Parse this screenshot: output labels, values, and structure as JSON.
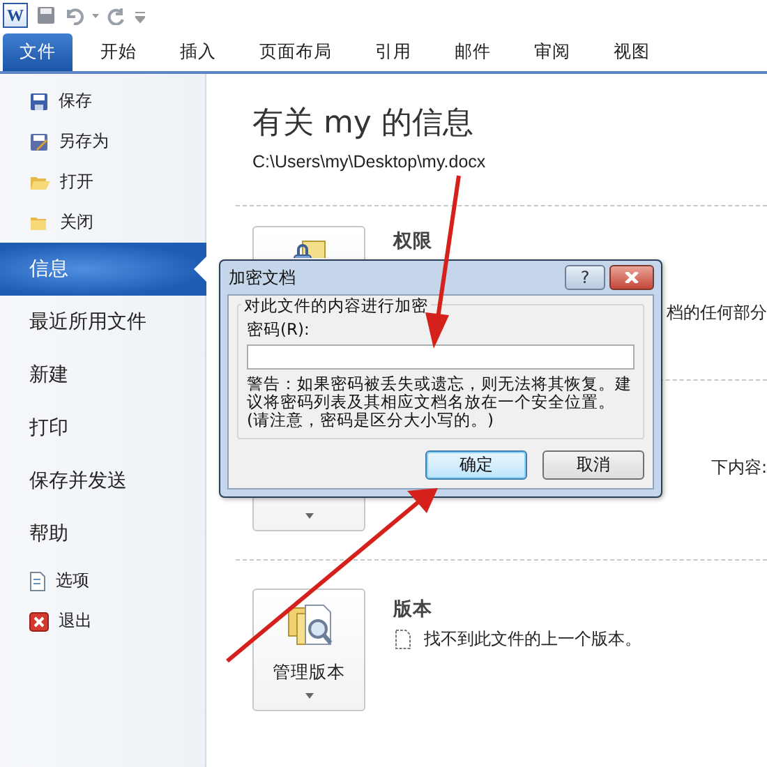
{
  "quick_access": {
    "logo": "W"
  },
  "ribbon_tabs": [
    {
      "label": "文件",
      "kind": "file",
      "selected": true
    },
    {
      "label": "开始",
      "kind": "tab",
      "selected": false
    },
    {
      "label": "插入",
      "kind": "tab",
      "selected": false
    },
    {
      "label": "页面布局",
      "kind": "tab",
      "selected": false
    },
    {
      "label": "引用",
      "kind": "tab",
      "selected": false
    },
    {
      "label": "邮件",
      "kind": "tab",
      "selected": false
    },
    {
      "label": "审阅",
      "kind": "tab",
      "selected": false
    },
    {
      "label": "视图",
      "kind": "tab",
      "selected": false
    }
  ],
  "sidebar": {
    "items": [
      {
        "label": "保存",
        "kind": "command",
        "selected": false
      },
      {
        "label": "另存为",
        "kind": "command",
        "selected": false
      },
      {
        "label": "打开",
        "kind": "command",
        "selected": false
      },
      {
        "label": "关闭",
        "kind": "command",
        "selected": false
      },
      {
        "label": "信息",
        "kind": "page",
        "selected": true
      },
      {
        "label": "最近所用文件",
        "kind": "page",
        "selected": false
      },
      {
        "label": "新建",
        "kind": "page",
        "selected": false
      },
      {
        "label": "打印",
        "kind": "page",
        "selected": false
      },
      {
        "label": "保存并发送",
        "kind": "page",
        "selected": false
      },
      {
        "label": "帮助",
        "kind": "page",
        "selected": false
      },
      {
        "label": "选项",
        "kind": "command",
        "selected": false
      },
      {
        "label": "退出",
        "kind": "command",
        "selected": false
      }
    ]
  },
  "info": {
    "title": "有关 my 的信息",
    "path": "C:\\Users\\my\\Desktop\\my.docx",
    "sections": [
      {
        "heading": "权限",
        "description": "档的任何部分"
      },
      {
        "description": "下内容:"
      },
      {
        "heading": "版本",
        "button_label": "管理版本",
        "description": "找不到此文件的上一个版本。"
      }
    ]
  },
  "dialog": {
    "title": "加密文档",
    "help_button": "?",
    "group_label": "对此文件的内容进行加密",
    "password_label": "密码(R):",
    "warning": "警告：如果密码被丢失或遗忘，则无法将其恢复。建议将密码列表及其相应文档名放在一个安全位置。(请注意，密码是区分大小写的。)",
    "buttons": [
      {
        "label": "确定",
        "selected": true
      },
      {
        "label": "取消",
        "selected": false
      }
    ]
  }
}
